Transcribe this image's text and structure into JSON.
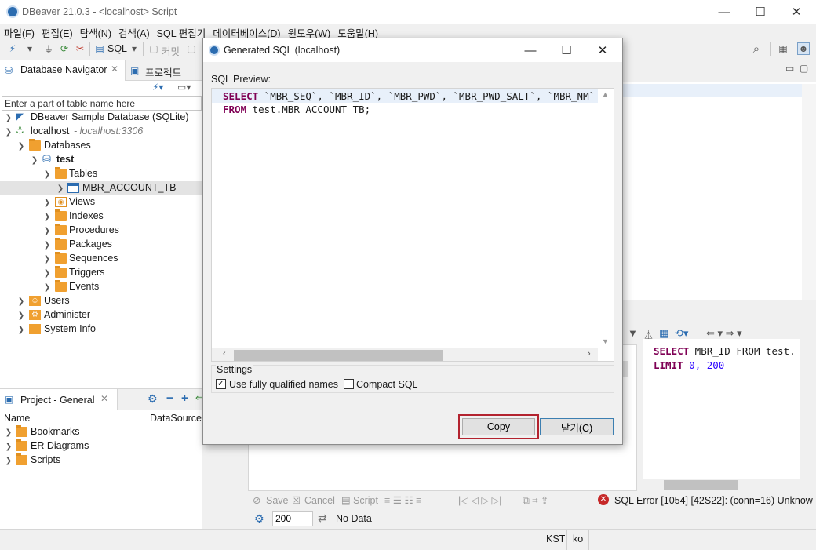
{
  "window": {
    "title": "DBeaver 21.0.3 - <localhost> Script",
    "controls": [
      "—",
      "☐",
      "✕"
    ]
  },
  "menu": [
    "파일(F)",
    "편집(E)",
    "탐색(N)",
    "검색(A)",
    "SQL 편집기",
    "데이터베이스(D)",
    "윈도우(W)",
    "도움말(H)"
  ],
  "toolbar": {
    "sql_label": "SQL",
    "commit_label": "커밋"
  },
  "navigator": {
    "tab_label": "Database Navigator",
    "other_tab_label": "프로젝트",
    "filter_placeholder": "Enter a part of table name here",
    "tree": {
      "sample_db": "DBeaver Sample Database (SQLite)",
      "localhost": "localhost",
      "localhost_port": " - localhost:3306",
      "databases": "Databases",
      "test": "test",
      "tables": "Tables",
      "mbr_table": "MBR_ACCOUNT_TB",
      "views": "Views",
      "indexes": "Indexes",
      "procedures": "Procedures",
      "packages": "Packages",
      "sequences": "Sequences",
      "triggers": "Triggers",
      "events": "Events",
      "users": "Users",
      "administer": "Administer",
      "system_info": "System Info"
    }
  },
  "project": {
    "tab_label": "Project - General",
    "col_name": "Name",
    "col_datasource": "DataSource",
    "items": [
      "Bookmarks",
      "ER Diagrams",
      "Scripts"
    ]
  },
  "editor_right": {
    "line1_kw": "SELECT",
    "line1_rest": " MBR_ID FROM test.",
    "line2_kw": "LIMIT",
    "line2_rest": " 0, 200"
  },
  "results": {
    "save": "Save",
    "cancel": "Cancel",
    "script": "Script",
    "limit_value": "200",
    "no_data": "No Data",
    "error_text": "SQL Error [1054] [42S22]: (conn=16) Unknow"
  },
  "status": {
    "timezone": "KST",
    "locale": "ko"
  },
  "dialog": {
    "title": "Generated SQL (localhost)",
    "preview_label": "SQL Preview:",
    "code": {
      "select_kw": "SELECT",
      "columns": " `MBR_SEQ`, `MBR_ID`, `MBR_PWD`, `MBR_PWD_SALT`, `MBR_NM`",
      "from_kw": "FROM",
      "table": " test.MBR_ACCOUNT_TB;"
    },
    "settings_label": "Settings",
    "opt_fully_qualified": "Use fully qualified names",
    "opt_fully_qualified_checked": true,
    "opt_compact": "Compact SQL",
    "opt_compact_checked": false,
    "copy_button": "Copy",
    "close_button": "닫기(C)"
  }
}
